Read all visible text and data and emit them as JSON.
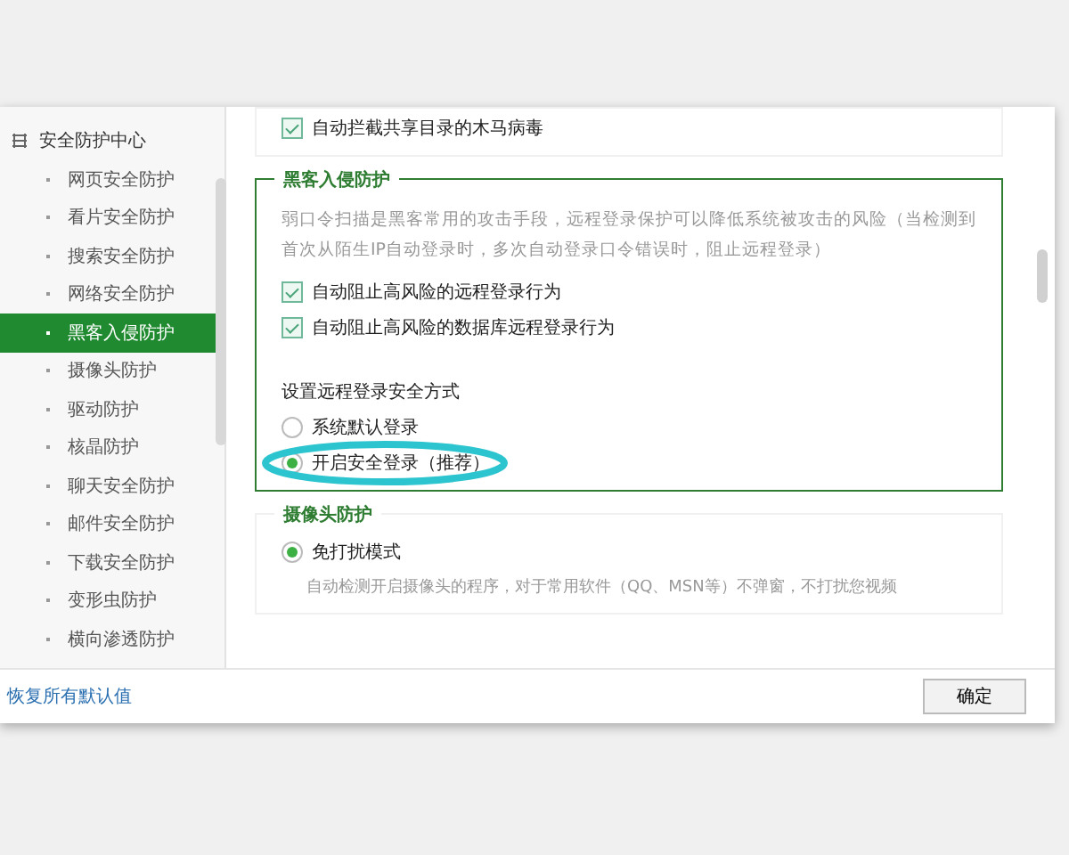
{
  "sidebar": {
    "group": "安全防护中心",
    "items": [
      {
        "label": "网页安全防护",
        "selected": false
      },
      {
        "label": "看片安全防护",
        "selected": false
      },
      {
        "label": "搜索安全防护",
        "selected": false
      },
      {
        "label": "网络安全防护",
        "selected": false
      },
      {
        "label": "黑客入侵防护",
        "selected": true
      },
      {
        "label": "摄像头防护",
        "selected": false
      },
      {
        "label": "驱动防护",
        "selected": false
      },
      {
        "label": "核晶防护",
        "selected": false
      },
      {
        "label": "聊天安全防护",
        "selected": false
      },
      {
        "label": "邮件安全防护",
        "selected": false
      },
      {
        "label": "下载安全防护",
        "selected": false
      },
      {
        "label": "变形虫防护",
        "selected": false
      },
      {
        "label": "横向渗透防护",
        "selected": false
      }
    ]
  },
  "sections": [
    {
      "highlighted": false,
      "blocks": [
        {
          "kind": "checkbox",
          "label": "自动拦截共享目录的木马病毒",
          "checked": true
        }
      ]
    },
    {
      "highlighted": true,
      "title": "黑客入侵防护",
      "blocks": [
        {
          "kind": "note",
          "text": "弱口令扫描是黑客常用的攻击手段，远程登录保护可以降低系统被攻击的风险（当检测到首次从陌生IP自动登录时，多次自动登录口令错误时，阻止远程登录）"
        },
        {
          "kind": "checkbox",
          "label": "自动阻止高风险的远程登录行为",
          "checked": true
        },
        {
          "kind": "checkbox",
          "label": "自动阻止高风险的数据库远程登录行为",
          "checked": true
        },
        {
          "kind": "heading",
          "text": "设置远程登录安全方式"
        },
        {
          "kind": "radio",
          "label": "系统默认登录",
          "selected": false,
          "circled": false
        },
        {
          "kind": "radio",
          "label": "开启安全登录（推荐）",
          "selected": true,
          "circled": true
        }
      ]
    },
    {
      "highlighted": false,
      "title": "摄像头防护",
      "blocks": [
        {
          "kind": "radio",
          "label": "免打扰模式",
          "selected": true,
          "circled": false
        },
        {
          "kind": "subnote",
          "text": "自动检测开启摄像头的程序，对于常用软件（QQ、MSN等）不弹窗，不打扰您视频"
        }
      ]
    }
  ],
  "footer": {
    "link": "恢复所有默认值",
    "button": "确定"
  }
}
